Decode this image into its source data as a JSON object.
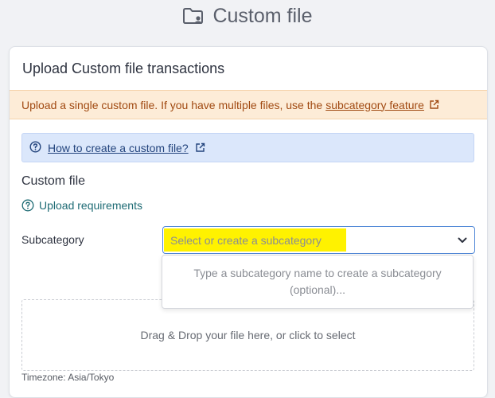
{
  "page": {
    "title": "Custom file",
    "title_icon": "folder-user-icon"
  },
  "card": {
    "header": "Upload Custom file transactions",
    "warning": {
      "text": "Upload a single custom file. If you have multiple files, use the",
      "link": "subcategory feature",
      "icon": "external-link-icon"
    },
    "info": {
      "icon": "help-circle-icon",
      "link": "How to create a custom file?",
      "link_icon": "external-link-icon"
    },
    "section_title": "Custom file",
    "upload_requirements": {
      "icon": "help-circle-icon",
      "label": "Upload requirements"
    },
    "subcategory": {
      "label": "Subcategory",
      "placeholder": "Select or create a subcategory",
      "dropdown_hint": "Type a subcategory name to create a subcategory (optional)..."
    },
    "dropzone": {
      "text": "Drag & Drop your file here, or click to select"
    },
    "timezone": "Timezone: Asia/Tokyo"
  },
  "colors": {
    "accent_blue": "#4e86d6",
    "warning_bg": "#fdecd7",
    "warning_text": "#a14a12",
    "info_bg": "#dbe7fb",
    "link_teal": "#1e6b74",
    "highlight": "#fff200"
  }
}
